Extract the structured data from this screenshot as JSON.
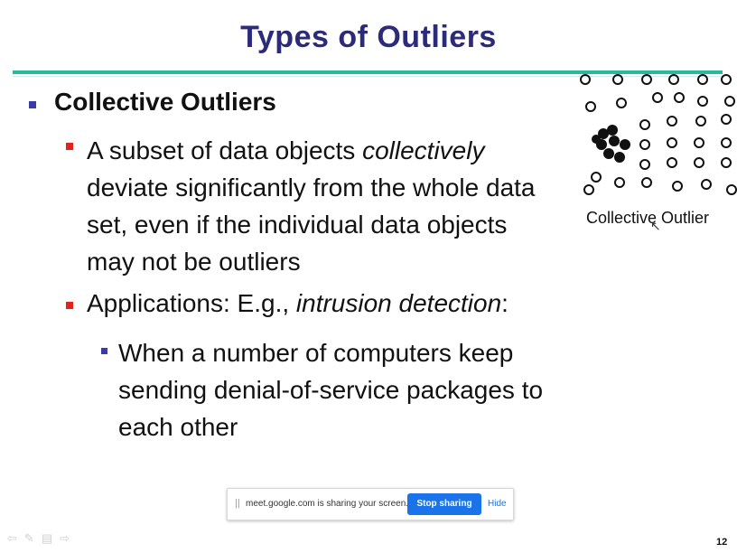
{
  "slide": {
    "title": "Types of Outliers",
    "heading": "Collective Outliers",
    "bullet1": {
      "part1": "A subset of data objects ",
      "italic": "collectively",
      "part2": " deviate significantly from the whole data set, even if the individual data objects may not be outliers"
    },
    "bullet2": {
      "part1": "Applications: E.g., ",
      "italic": "intrusion detection",
      "part2": ":"
    },
    "subbullet": "When a number of computers keep sending denial-of-service packages to each other",
    "figure_caption": "Collective Outlier",
    "page_number": "12"
  },
  "share_bar": {
    "grip_icon": "||",
    "message": "meet.google.com is sharing your screen.",
    "stop_label": "Stop sharing",
    "hide_label": "Hide"
  },
  "colors": {
    "title": "#2b2b7a",
    "accent_rule": "#2bb7a0",
    "bullet_blue": "#3a3aa8",
    "bullet_red": "#e0231b",
    "button_blue": "#1a73e8"
  },
  "icons": {
    "cursor": "mouse-pointer-icon",
    "toolbar": [
      "prev-arrow-icon",
      "pen-icon",
      "menu-icon",
      "next-arrow-icon"
    ]
  }
}
